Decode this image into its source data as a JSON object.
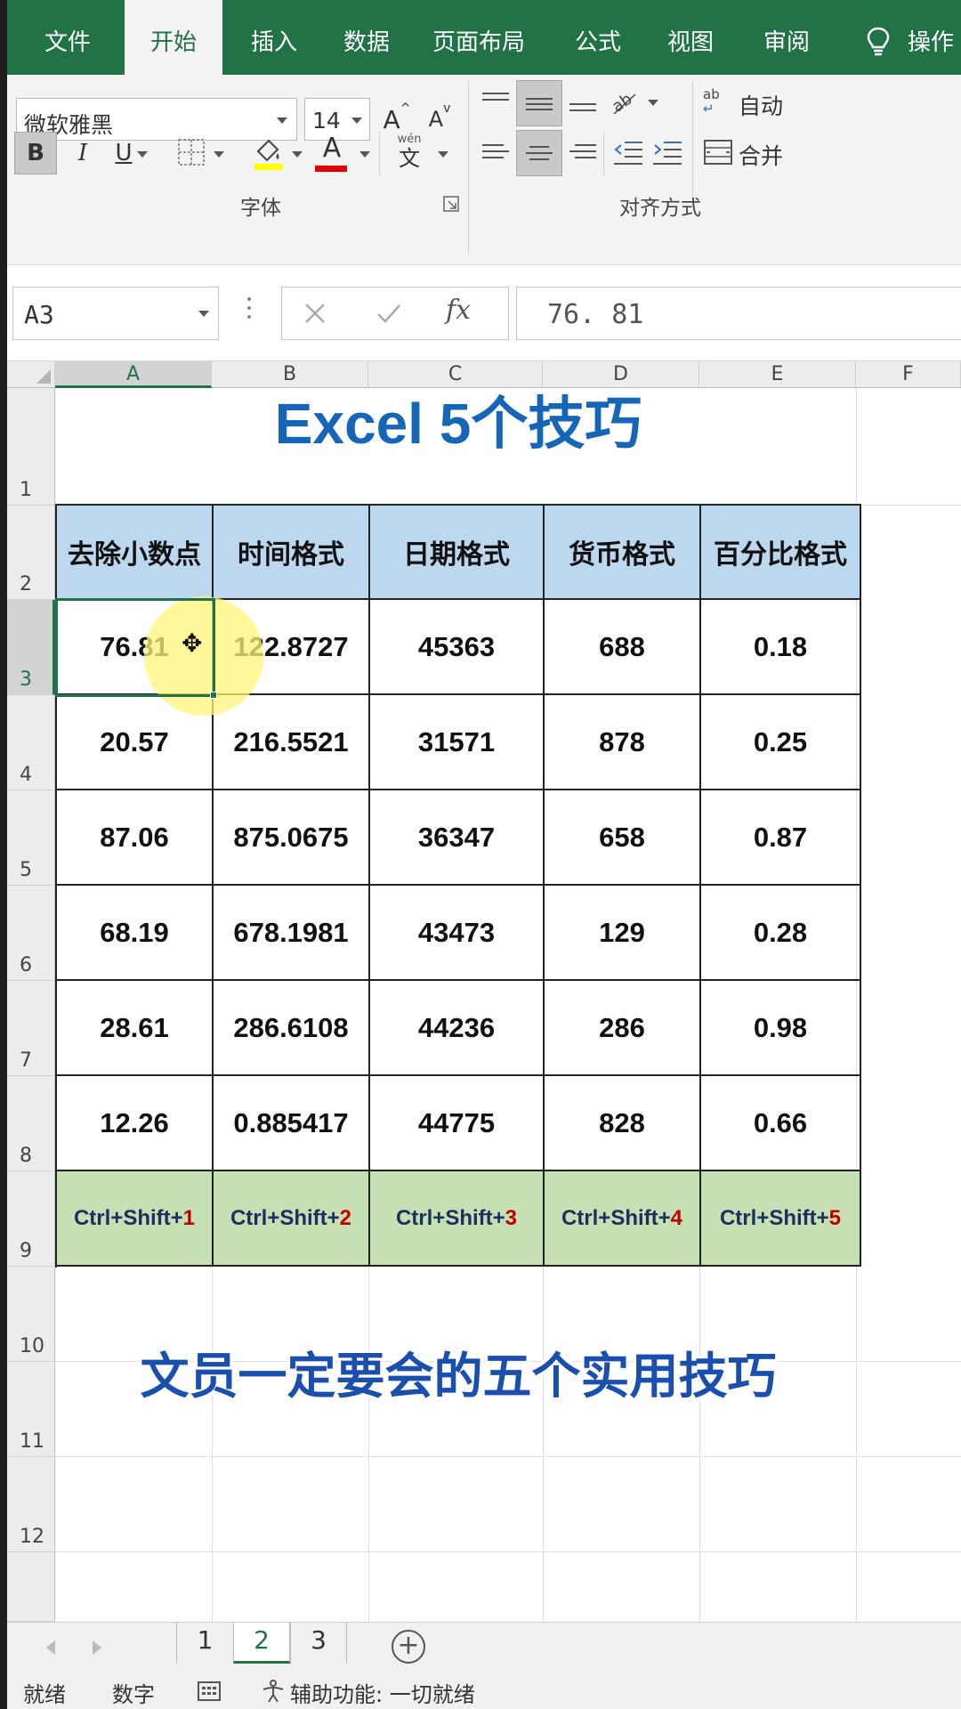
{
  "ribbon_tabs": [
    "文件",
    "开始",
    "插入",
    "数据",
    "页面布局",
    "公式",
    "视图",
    "审阅",
    "操作"
  ],
  "active_tab": "开始",
  "font": {
    "name": "微软雅黑",
    "size": "14",
    "bold_label": "B",
    "italic_label": "I",
    "underline_label": "U",
    "grow_label": "A",
    "shrink_label": "A",
    "font_color_label": "A",
    "phonetic_top": "wén",
    "phonetic_bottom": "文",
    "fill_color": "#ffff00",
    "font_color": "#e00000",
    "group_label": "字体"
  },
  "alignment": {
    "wrap_label": "自动",
    "merge_label": "合并",
    "wrap_icon_text": "ab",
    "group_label": "对齐方式"
  },
  "formula_bar": {
    "name_box": "A3",
    "fx_label": "fx",
    "value": "76. 81"
  },
  "columns": [
    "A",
    "B",
    "C",
    "D",
    "E",
    "F"
  ],
  "selected_column": "A",
  "rows": [
    "1",
    "2",
    "3",
    "4",
    "5",
    "6",
    "7",
    "8",
    "9",
    "10",
    "11",
    "12"
  ],
  "selected_row": "3",
  "sheet": {
    "title": "Excel 5个技巧",
    "headers": [
      "去除小数点",
      "时间格式",
      "日期格式",
      "货币格式",
      "百分比格式"
    ],
    "data": [
      [
        "76.81",
        "122.8727",
        "45363",
        "688",
        "0.18"
      ],
      [
        "20.57",
        "216.5521",
        "31571",
        "878",
        "0.25"
      ],
      [
        "87.06",
        "875.0675",
        "36347",
        "658",
        "0.87"
      ],
      [
        "68.19",
        "678.1981",
        "43473",
        "129",
        "0.28"
      ],
      [
        "28.61",
        "286.6108",
        "44236",
        "286",
        "0.98"
      ],
      [
        "12.26",
        "0.885417",
        "44775",
        "828",
        "0.66"
      ]
    ],
    "shortcut_prefix": "Ctrl+Shift+",
    "shortcut_keys": [
      "1",
      "2",
      "3",
      "4",
      "5"
    ],
    "subtitle": "文员一定要会的五个实用技巧",
    "header_color": "#bdd7ee",
    "shortcut_color": "#c6e0b4",
    "title_color": "#1565b8"
  },
  "sheet_tabs": [
    "1",
    "2",
    "3"
  ],
  "active_sheet": "2",
  "add_sheet_label": "+",
  "status": {
    "ready": "就绪",
    "mode": "数字",
    "accessibility": "辅助功能: 一切就绪"
  }
}
